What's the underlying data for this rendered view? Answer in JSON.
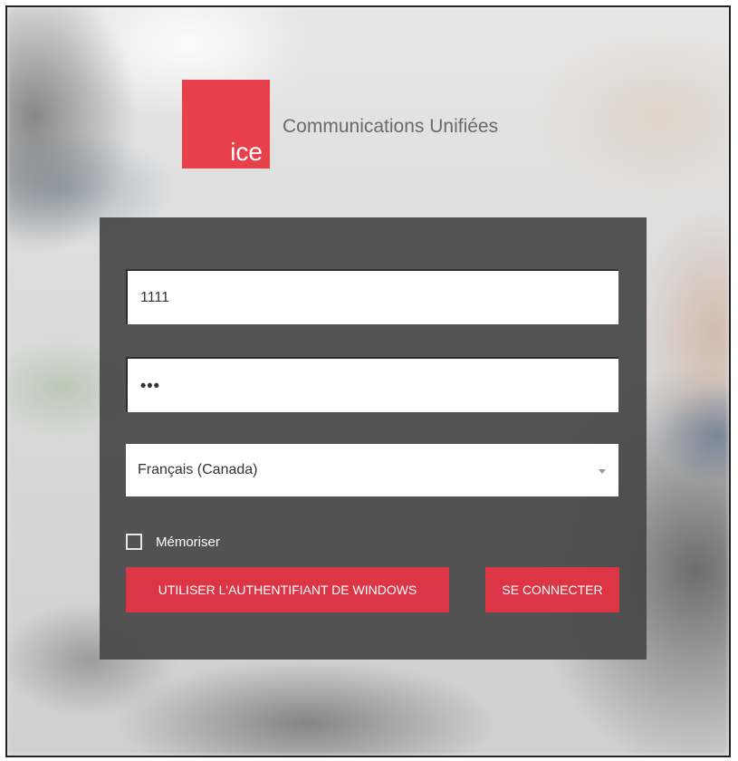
{
  "app": {
    "logo_text": "ice",
    "title": "Communications Unifiées",
    "brand_color": "#e8404a"
  },
  "login": {
    "username_value": "1111",
    "password_value": "•••",
    "language_selected": "Français (Canada)",
    "remember_label": "Mémoriser",
    "remember_checked": false,
    "windows_auth_label": "UTILISER L'AUTHENTIFIANT DE WINDOWS",
    "connect_label": "SE CONNECTER",
    "button_color": "#dc3545"
  },
  "icons": {
    "select_caret": "caret-down-icon",
    "checkbox": "checkbox-unchecked-icon"
  }
}
